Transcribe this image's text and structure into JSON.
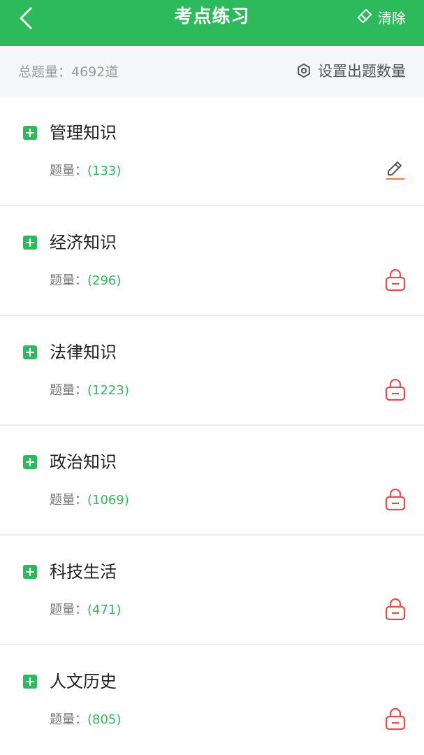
{
  "header": {
    "title": "考点练习",
    "clear_label": "清除",
    "back_icon": "chevron-left-icon",
    "clear_icon": "eraser-icon"
  },
  "summary": {
    "total_text": "总题量：4692道",
    "settings_label": "设置出题数量",
    "settings_icon": "gear-icon"
  },
  "items": [
    {
      "title": "管理知识",
      "count_label": "题量：",
      "count": "(133)",
      "status_icon": "pencil-icon"
    },
    {
      "title": "经济知识",
      "count_label": "题量：",
      "count": "(296)",
      "status_icon": "lock-icon"
    },
    {
      "title": "法律知识",
      "count_label": "题量：",
      "count": "(1223)",
      "status_icon": "lock-icon"
    },
    {
      "title": "政治知识",
      "count_label": "题量：",
      "count": "(1069)",
      "status_icon": "lock-icon"
    },
    {
      "title": "科技生活",
      "count_label": "题量：",
      "count": "(471)",
      "status_icon": "lock-icon"
    },
    {
      "title": "人文历史",
      "count_label": "题量：",
      "count": "(805)",
      "status_icon": "lock-icon"
    }
  ],
  "colors": {
    "accent": "#2cba5c",
    "lock": "#e84c4c",
    "pencil_underline": "#f07a3a"
  }
}
